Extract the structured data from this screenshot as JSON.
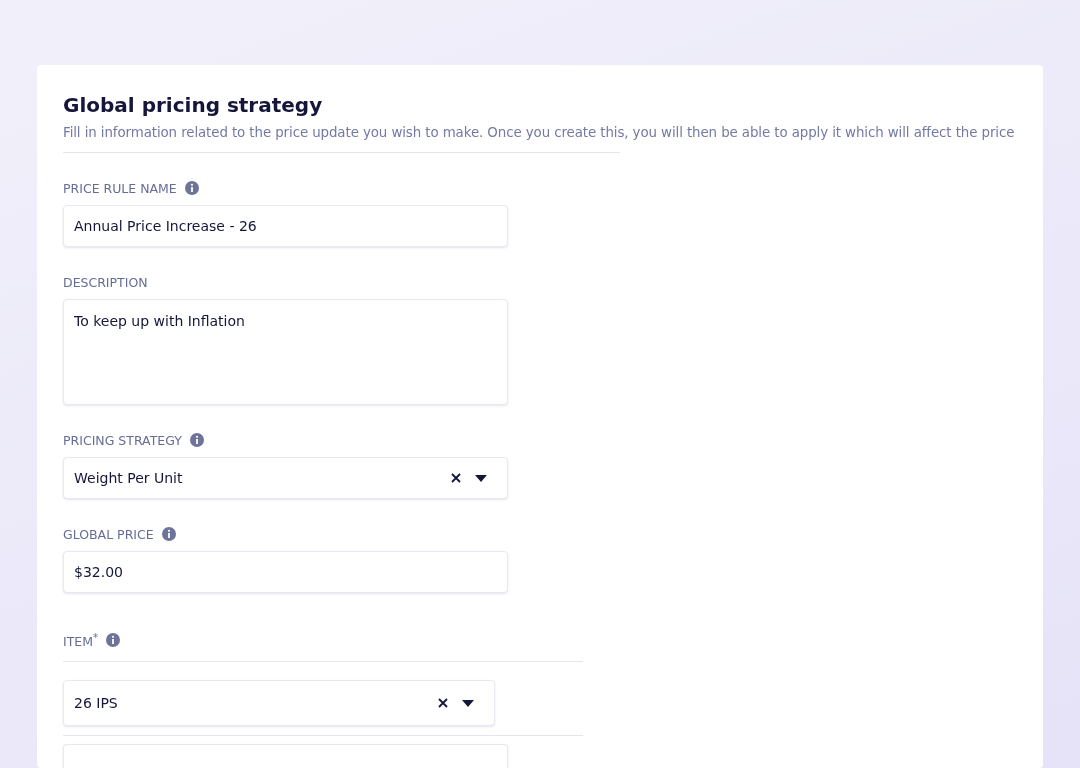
{
  "title": "Global pricing strategy",
  "subtitle": "Fill in information related to the price update you wish to make. Once you create this, you will then be able to apply it which will affect the price",
  "fields": [
    {
      "kind": "text",
      "label": "PRICE RULE NAME",
      "info": true,
      "value": "Annual Price Increase - 26"
    },
    {
      "kind": "textarea",
      "label": "DESCRIPTION",
      "info": false,
      "value": "To keep up with Inflation"
    },
    {
      "kind": "select",
      "label": "PRICING STRATEGY",
      "info": true,
      "value": "Weight Per Unit"
    },
    {
      "kind": "text",
      "label": "GLOBAL PRICE",
      "info": true,
      "value": "$32.00"
    },
    {
      "kind": "item-select",
      "label": "ITEM$^{*}$",
      "info": true,
      "value": "26 IPS"
    },
    {
      "kind": "stub"
    }
  ]
}
